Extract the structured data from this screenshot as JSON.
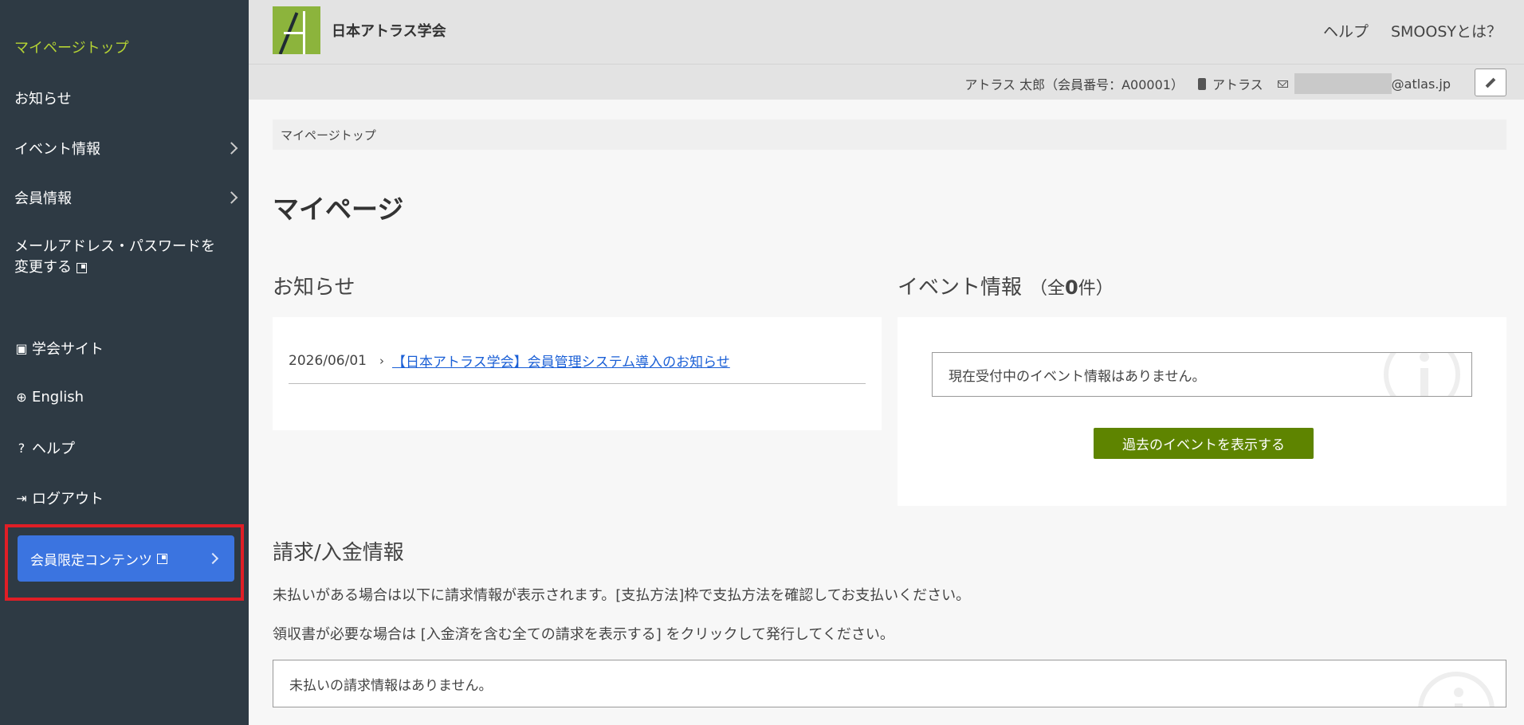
{
  "sidebar": {
    "top": "マイページトップ",
    "news": "お知らせ",
    "events": "イベント情報",
    "member": "会員情報",
    "change_line1": "メールアドレス・パスワードを",
    "change_line2": "変更する",
    "society_site": "学会サイト",
    "english": "English",
    "help": "ヘルプ",
    "logout": "ログアウト",
    "members_only": "会員限定コンテンツ"
  },
  "header": {
    "org_name": "日本アトラス学会",
    "help": "ヘルプ",
    "about": "SMOOSYとは？"
  },
  "user": {
    "name": "アトラス 太郎（会員番号：A00001）",
    "org": "アトラス",
    "email_domain": "@atlas.jp"
  },
  "breadcrumb": "マイページトップ",
  "page_title": "マイページ",
  "news": {
    "title": "お知らせ",
    "items": [
      {
        "date": "2026/06/01",
        "text": "【日本アトラス学会】会員管理システム導入のお知らせ"
      }
    ]
  },
  "events": {
    "title": "イベント情報",
    "count_prefix": "（全",
    "count": "0",
    "count_suffix": "件）",
    "empty_message": "現在受付中のイベント情報はありません。",
    "past_button": "過去のイベントを表示する"
  },
  "billing": {
    "title": "請求/入金情報",
    "line1": "未払いがある場合は以下に請求情報が表示されます。[支払方法]枠で支払方法を確認してお支払いください。",
    "line2": "領収書が必要な場合は [入金済を含む全ての請求を表示する] をクリックして発行してください。",
    "empty_message": "未払いの請求情報はありません。"
  },
  "colors": {
    "sidebar_bg": "#2e3a44",
    "active_item": "#b5d334",
    "members_button": "#3b74e0",
    "highlight_border": "#e01e26",
    "primary_button": "#5e8400",
    "link": "#1a5fd6"
  }
}
